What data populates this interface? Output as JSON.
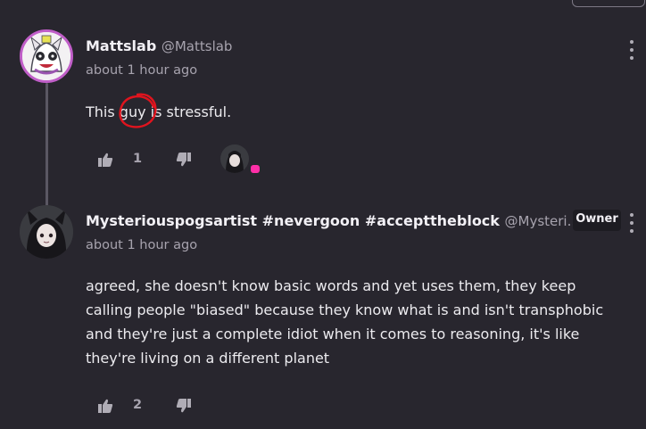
{
  "comments": [
    {
      "author": "Mattslab",
      "handle": "@Mattslab",
      "time": "about 1 hour ago",
      "text_before": "This ",
      "highlight": "guy",
      "text_after": " is stressful.",
      "upvotes": "1"
    },
    {
      "author": "Mysteriouspogsartist #nevergoon #accepttheblock",
      "handle": "@Mysteri...",
      "badge": "Owner",
      "time": "about 1 hour ago",
      "text_lines": [
        "agreed, she doesn't know basic words and yet uses them, they keep",
        "calling people \"biased\" because they know what is and isn't transphobic",
        "and they're just a complete idiot when it comes to reasoning, it's like",
        "they're living on a different planet"
      ],
      "upvotes": "2"
    }
  ],
  "colors": {
    "background": "#28262e",
    "annotation_circle": "#e0141e",
    "badge_pink": "#ff2fa8"
  },
  "icons": [
    "thumbs-up-icon",
    "thumbs-down-icon",
    "more-options-icon"
  ]
}
